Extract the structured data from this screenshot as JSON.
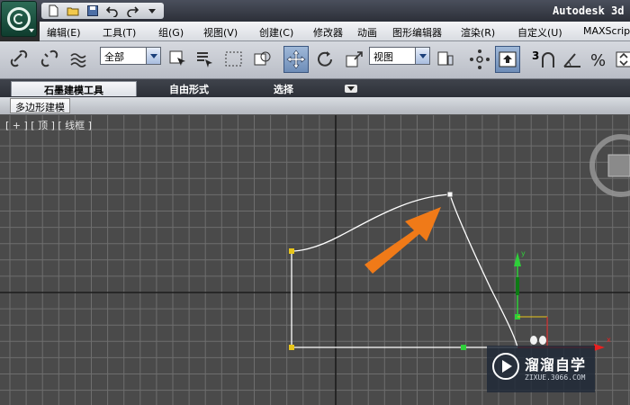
{
  "app": {
    "title": "Autodesk 3d"
  },
  "menu": [
    "编辑(E)",
    "工具(T)",
    "组(G)",
    "视图(V)",
    "创建(C)",
    "修改器",
    "动画",
    "图形编辑器",
    "渲染(R)",
    "自定义(U)",
    "MAXScript"
  ],
  "toolbar": {
    "selection_filter": "全部",
    "reference_coord": "视图",
    "snap_label": "3"
  },
  "ribbon": {
    "tabs": [
      "石墨建模工具",
      "自由形式",
      "选择"
    ],
    "active_tab": "石墨建模工具",
    "panel_label": "多边形建模"
  },
  "viewport": {
    "label": "[ + ] [ 顶 ] [ 线框 ]",
    "grid_color": "#6e6e6e",
    "background": "#4a4a4a",
    "spline_color": "#ffffff",
    "arrow_color": "#f07a18"
  },
  "watermark": {
    "name": "溜溜自学",
    "url": "ZIXUE.3066.COM"
  }
}
